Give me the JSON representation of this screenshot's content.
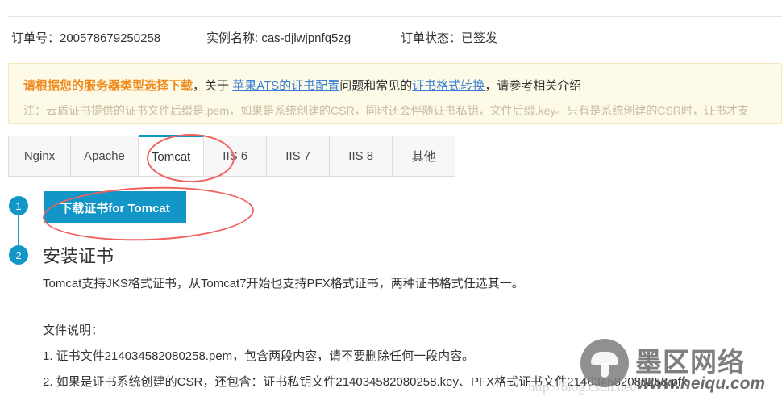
{
  "order": {
    "order_no_label": "订单号：200578679250258",
    "instance_label": "实例名称: cas-djlwjpnfq5zg",
    "status_label": "订单状态：已签发"
  },
  "notice": {
    "strong": "请根据您的服务器类型选择下载",
    "sep1": "，关于 ",
    "link1": "苹果ATS的证书配置",
    "mid": "问题和常见的",
    "link2": "证书格式转换",
    "tail": "，请参考相关介绍",
    "note": "注：云盾证书提供的证书文件后缀是.pem，如果是系统创建的CSR，同时还会伴随证书私钥，文件后缀.key。只有是系统创建的CSR时，证书才支"
  },
  "tabs": {
    "items": [
      {
        "label": "Nginx",
        "active": false
      },
      {
        "label": "Apache",
        "active": false
      },
      {
        "label": "Tomcat",
        "active": true
      },
      {
        "label": "IIS 6",
        "active": false
      },
      {
        "label": "IIS 7",
        "active": false
      },
      {
        "label": "IIS 8",
        "active": false
      },
      {
        "label": "其他",
        "active": false
      }
    ]
  },
  "steps": {
    "step1_number": "1",
    "step2_number": "2",
    "download_button": "下载证书for Tomcat",
    "install_title": "安装证书",
    "install_desc": "Tomcat支持JKS格式证书，从Tomcat7开始也支持PFX格式证书，两种证书格式任选其一。",
    "files_label": "文件说明：",
    "files": [
      "1. 证书文件214034582080258.pem，包含两段内容，请不要删除任何一段内容。",
      "2. 如果是证书系统创建的CSR，还包含：证书私钥文件214034582080258.key、PFX格式证书文件214034582080258.pfx"
    ]
  },
  "watermark": {
    "brand_cn": "墨区网络",
    "url": "www.heiqu.com",
    "faint": "http://blog.csdn.net/"
  },
  "colors": {
    "accent_blue": "#1296c8",
    "tab_active_border": "#0d93c4",
    "notice_bg": "#fdfae8",
    "notice_border": "#f3e9bd",
    "notice_strong": "#ef8b1c",
    "notice_link": "#3a7fd5",
    "annotation_red": "#f06260"
  }
}
